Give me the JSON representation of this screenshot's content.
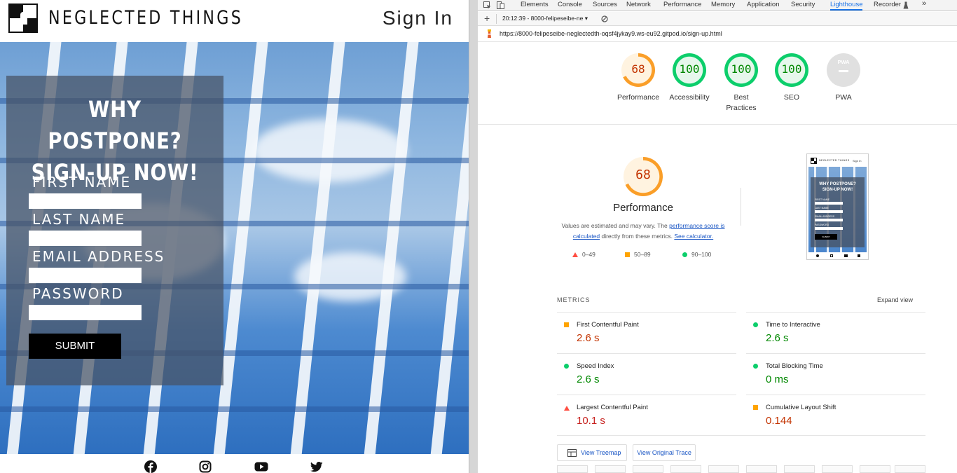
{
  "site": {
    "brand": "NEGLECTED THINGS",
    "signin_link": "Sign In",
    "panel_title_line1": "WHY POSTPONE?",
    "panel_title_line2": "SIGN-UP NOW!",
    "fields": [
      {
        "label": "FIRST NAME",
        "value": ""
      },
      {
        "label": "LAST NAME",
        "value": ""
      },
      {
        "label": "EMAIL ADDRESS",
        "value": ""
      },
      {
        "label": "PASSWORD",
        "value": ""
      }
    ],
    "submit_label": "SUBMIT",
    "social_icons": [
      "facebook-icon",
      "instagram-icon",
      "youtube-icon",
      "twitter-icon"
    ]
  },
  "devtools": {
    "tabs": [
      "Elements",
      "Console",
      "Sources",
      "Network",
      "Performance",
      "Memory",
      "Application",
      "Security",
      "Lighthouse",
      "Recorder"
    ],
    "active_tab": "Lighthouse",
    "report_select": "20:12:39 - 8000-felipeseibe-ne",
    "url": "https://8000-felipeseibe-neglectedth-oqsf4jykay9.ws-eu92.gitpod.io/sign-up.html",
    "gauges": [
      {
        "label": "Performance",
        "value": "68",
        "score": 68,
        "color": "#fa9e28",
        "text_color": "#c33300",
        "bg": "#fff3e0"
      },
      {
        "label": "Accessibility",
        "value": "100",
        "score": 100,
        "color": "#0cce6b",
        "text_color": "#008800",
        "bg": "#e6f7ec"
      },
      {
        "label_line1": "Best",
        "label_line2": "Practices",
        "label": "Best Practices",
        "value": "100",
        "score": 100,
        "color": "#0cce6b",
        "text_color": "#008800",
        "bg": "#e6f7ec"
      },
      {
        "label": "SEO",
        "value": "100",
        "score": 100,
        "color": "#0cce6b",
        "text_color": "#008800",
        "bg": "#e6f7ec"
      },
      {
        "label": "PWA",
        "value": "PWA",
        "color": "#cccccc",
        "text_color": "#ffffff",
        "bg": "#e0e0e0"
      }
    ],
    "perf_score": "68",
    "perf_title": "Performance",
    "perf_desc_1": "Values are estimated and may vary. The ",
    "perf_desc_link1": "performance score is calculated",
    "perf_desc_2": " directly from these metrics. ",
    "perf_desc_link2": "See calculator.",
    "legend": [
      "0–49",
      "50–89",
      "90–100"
    ],
    "thumb": {
      "brand": "NEGLECTED THINGS",
      "signin": "Sign In",
      "title_line1": "WHY POSTPONE?",
      "title_line2": "SIGN-UP NOW!",
      "fields": [
        "FIRST NAME",
        "LAST NAME",
        "EMAIL ADDRESS",
        "PASSWORD"
      ],
      "submit": "SUBMIT"
    },
    "metrics_header": "METRICS",
    "expand_view": "Expand view",
    "metrics": [
      {
        "name": "First Contentful Paint",
        "value": "2.6 s",
        "status": "average"
      },
      {
        "name": "Time to Interactive",
        "value": "2.6 s",
        "status": "pass"
      },
      {
        "name": "Speed Index",
        "value": "2.6 s",
        "status": "pass"
      },
      {
        "name": "Total Blocking Time",
        "value": "0 ms",
        "status": "pass"
      },
      {
        "name": "Largest Contentful Paint",
        "value": "10.1 s",
        "status": "fail"
      },
      {
        "name": "Cumulative Layout Shift",
        "value": "0.144",
        "status": "average"
      }
    ],
    "status_colors": {
      "pass": "#0cce6b",
      "average": "#ffa400",
      "fail": "#ff4e42"
    },
    "value_colors": {
      "pass": "#008800",
      "average": "#c33300",
      "fail": "#c7221f"
    },
    "btn_treemap": "View Treemap",
    "btn_trace": "View Original Trace"
  }
}
